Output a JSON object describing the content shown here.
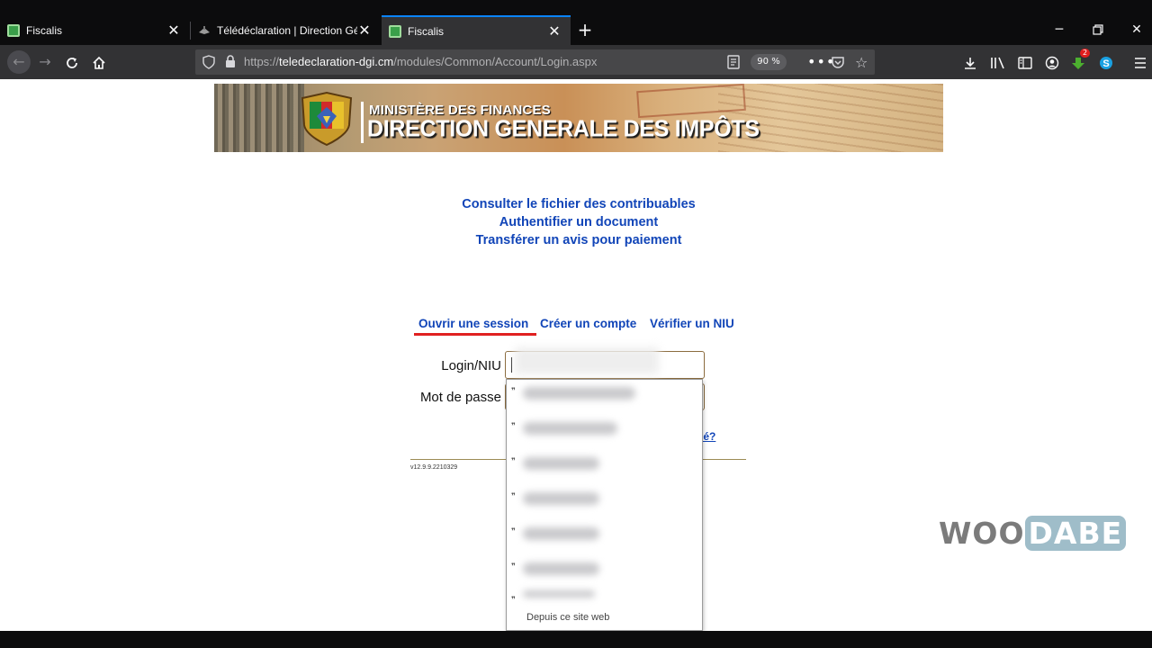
{
  "browser": {
    "tabs": [
      {
        "title": "Fiscalis",
        "active": false
      },
      {
        "title": "Télédéclaration | Direction Géné",
        "active": false
      },
      {
        "title": "Fiscalis",
        "active": true
      }
    ],
    "url": {
      "scheme": "https://",
      "host": "teledeclaration-dgi.cm",
      "path": "/modules/Common/Account/Login.aspx"
    },
    "zoom": "90 %",
    "downloads_badge": "2",
    "accent_color": "#0a84ff"
  },
  "banner": {
    "title_line1": "MINISTÈRE DES FINANCES",
    "title_line2": "DIRECTION GENERALE DES IMPÔTS"
  },
  "quick_links": [
    "Consulter le fichier des contribuables",
    "Authentifier un document",
    "Transférer un avis pour paiement"
  ],
  "auth_tabs": {
    "login": "Ouvrir une session",
    "create": "Créer un compte",
    "verify": "Vérifier un NIU"
  },
  "form": {
    "login_label": "Login/NIU",
    "password_label": "Mot de passe",
    "forgot_link": "ublié?",
    "version": "v12.9.9.2210329"
  },
  "autocomplete": {
    "footer": "Depuis ce site web"
  },
  "watermark": {
    "part1": "WOO",
    "part2": "DABE"
  },
  "colors": {
    "link": "#1145b8",
    "active_tab_underline": "#e02020"
  }
}
